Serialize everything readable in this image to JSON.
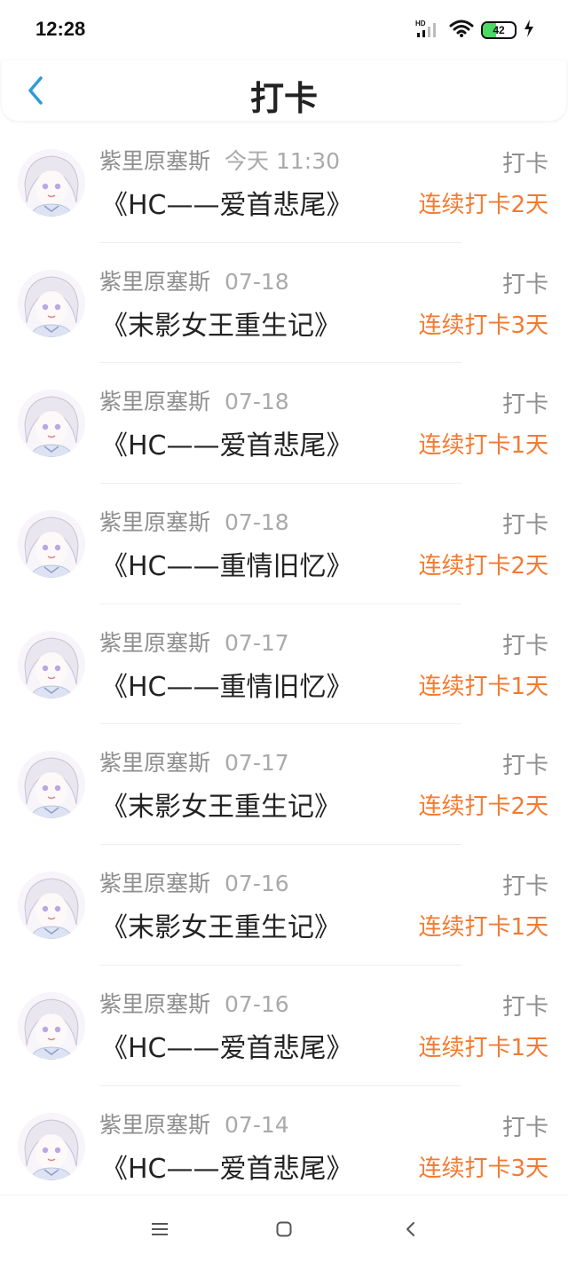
{
  "status": {
    "time": "12:28",
    "battery_level": "42",
    "battery_fraction": 0.42,
    "network_label": "HD",
    "icons": [
      "hd-signal-icon",
      "wifi-icon",
      "battery-icon",
      "charging-icon"
    ]
  },
  "header": {
    "title": "打卡",
    "back_icon": "chevron-left-icon",
    "accent_color": "#2d9cdb"
  },
  "colors": {
    "streak": "#f47a30",
    "meta": "#8e8e8e"
  },
  "records": [
    {
      "user": "紫里原塞斯",
      "date": "今天 11:30",
      "title": "《HC——爱首悲尾》",
      "action": "打卡",
      "streak": "连续打卡2天"
    },
    {
      "user": "紫里原塞斯",
      "date": "07-18",
      "title": "《末影女王重生记》",
      "action": "打卡",
      "streak": "连续打卡3天"
    },
    {
      "user": "紫里原塞斯",
      "date": "07-18",
      "title": "《HC——爱首悲尾》",
      "action": "打卡",
      "streak": "连续打卡1天"
    },
    {
      "user": "紫里原塞斯",
      "date": "07-18",
      "title": "《HC——重情旧忆》",
      "action": "打卡",
      "streak": "连续打卡2天"
    },
    {
      "user": "紫里原塞斯",
      "date": "07-17",
      "title": "《HC——重情旧忆》",
      "action": "打卡",
      "streak": "连续打卡1天"
    },
    {
      "user": "紫里原塞斯",
      "date": "07-17",
      "title": "《末影女王重生记》",
      "action": "打卡",
      "streak": "连续打卡2天"
    },
    {
      "user": "紫里原塞斯",
      "date": "07-16",
      "title": "《末影女王重生记》",
      "action": "打卡",
      "streak": "连续打卡1天"
    },
    {
      "user": "紫里原塞斯",
      "date": "07-16",
      "title": "《HC——爱首悲尾》",
      "action": "打卡",
      "streak": "连续打卡1天"
    },
    {
      "user": "紫里原塞斯",
      "date": "07-14",
      "title": "《HC——爱首悲尾》",
      "action": "打卡",
      "streak": "连续打卡3天"
    }
  ],
  "nav": {
    "icons": [
      "menu-icon",
      "home-square-icon",
      "back-triangle-icon"
    ]
  }
}
